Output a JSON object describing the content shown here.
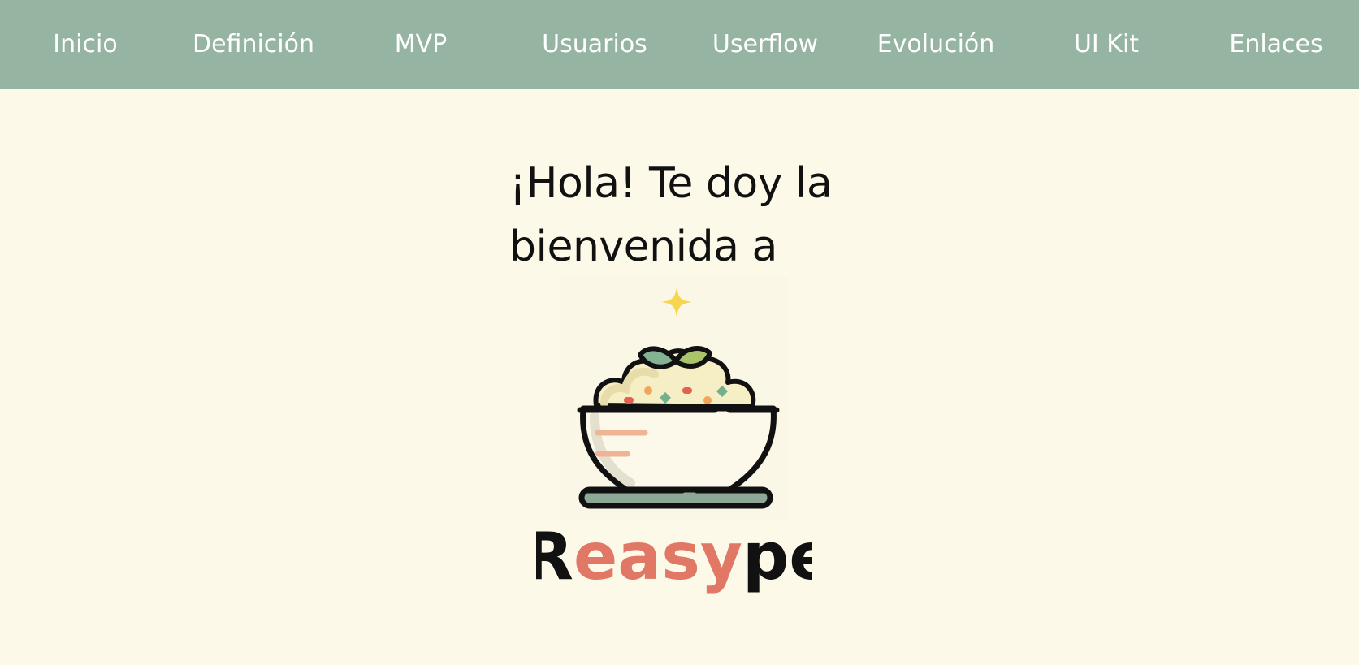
{
  "nav": {
    "items": [
      {
        "label": "Inicio"
      },
      {
        "label": "Definición"
      },
      {
        "label": "MVP"
      },
      {
        "label": "Usuarios"
      },
      {
        "label": "Userflow"
      },
      {
        "label": "Evolución"
      },
      {
        "label": "UI Kit"
      },
      {
        "label": "Enlaces"
      }
    ]
  },
  "hero": {
    "greeting": "¡Hola! Te doy la\nbienvenida a",
    "logo": {
      "icon": "rice-bowl-icon",
      "sparkle_icon": "sparkle-icon",
      "wordmark": {
        "first": "R",
        "middle": "easy",
        "last": "pe"
      }
    }
  },
  "colors": {
    "nav_background": "#95b4a1",
    "page_background": "#fdf9e8",
    "nav_text": "#ffffff",
    "brand_accent": "#e07865",
    "text": "#111111"
  }
}
